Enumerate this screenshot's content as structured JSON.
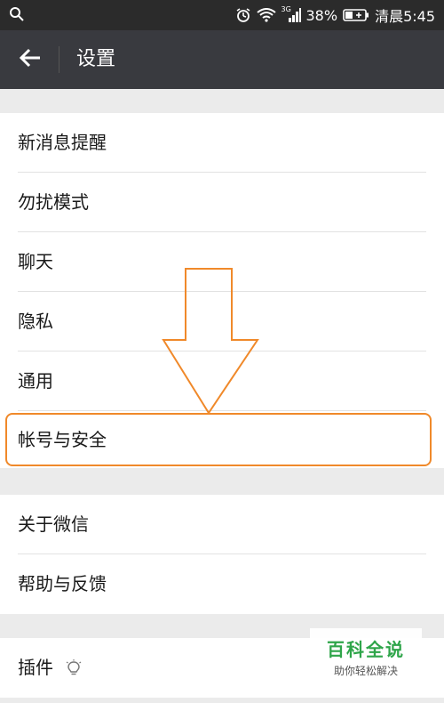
{
  "status_bar": {
    "battery_percent": "38%",
    "time": "清晨5:45",
    "network_tag": "3G",
    "icons": [
      "search-icon",
      "alarm-icon",
      "wifi-icon",
      "signal-icon",
      "battery-icon"
    ]
  },
  "header": {
    "title": "设置",
    "back_icon": "back-arrow-icon"
  },
  "groups": [
    {
      "items": [
        {
          "label": "新消息提醒"
        },
        {
          "label": "勿扰模式"
        },
        {
          "label": "聊天"
        },
        {
          "label": "隐私"
        },
        {
          "label": "通用"
        },
        {
          "label": "帐号与安全",
          "highlighted": true
        }
      ]
    },
    {
      "items": [
        {
          "label": "关于微信"
        },
        {
          "label": "帮助与反馈"
        }
      ]
    },
    {
      "items": [
        {
          "label": "插件",
          "icon": "bulb-icon"
        }
      ]
    }
  ],
  "annotation": {
    "arrow_color": "#f0892a",
    "highlight_color": "#f0892a"
  },
  "watermark": {
    "title": "百科全说",
    "subtitle": "助你轻松解决",
    "color": "#2fa54a"
  },
  "colors": {
    "appbar": "#393a3f",
    "statusbar": "#2b2b2b",
    "background": "#ebebeb"
  }
}
